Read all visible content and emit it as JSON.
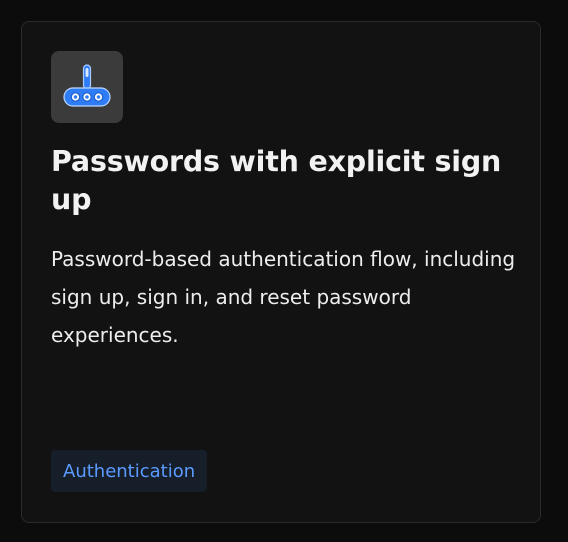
{
  "card": {
    "icon": "password-keypad-icon",
    "title": "Passwords with explicit sign up",
    "description": "Password-based authentication flow, including sign up, sign in, and reset password experiences.",
    "tag": "Authentication"
  },
  "colors": {
    "background": "#0c0c0c",
    "card_background": "#121212",
    "card_border": "#2a2a2a",
    "icon_tile": "#3b3b3b",
    "icon_blue": "#2f7df6",
    "tag_background": "#161e2a",
    "tag_text": "#5b9bff"
  }
}
